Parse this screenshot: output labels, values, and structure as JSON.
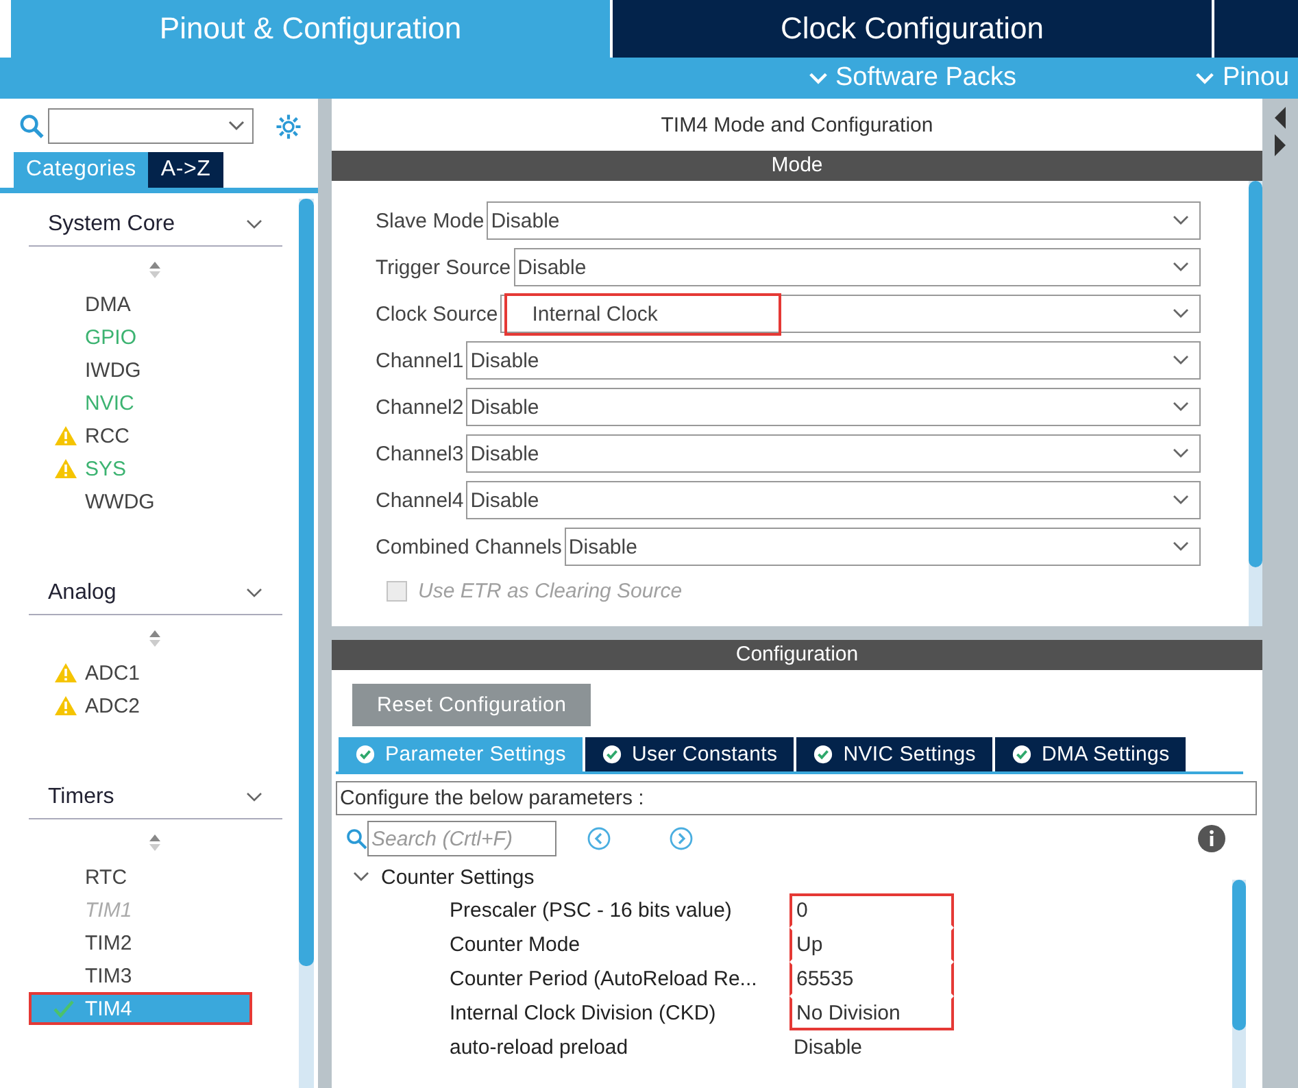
{
  "top_tabs": [
    {
      "label": "Pinout & Configuration",
      "selected": true
    },
    {
      "label": "Clock Configuration",
      "selected": false
    },
    {
      "selected": false
    }
  ],
  "sub_menu": [
    {
      "label": "Software Packs"
    },
    {
      "label": "Pinou"
    }
  ],
  "sidebar": {
    "tabs": [
      {
        "label": "Categories",
        "selected": true
      },
      {
        "label": "A->Z",
        "selected": false
      }
    ],
    "categories": [
      {
        "title": "System Core",
        "expanded": true,
        "items": [
          {
            "label": "DMA",
            "kind": "default",
            "warning": false,
            "checked": false,
            "selected": false,
            "highlighted": false
          },
          {
            "label": "GPIO",
            "kind": "configured",
            "warning": false,
            "checked": false,
            "selected": false,
            "highlighted": false
          },
          {
            "label": "IWDG",
            "kind": "default",
            "warning": false,
            "checked": false,
            "selected": false,
            "highlighted": false
          },
          {
            "label": "NVIC",
            "kind": "configured",
            "warning": false,
            "checked": false,
            "selected": false,
            "highlighted": false
          },
          {
            "label": "RCC",
            "kind": "default",
            "warning": true,
            "checked": false,
            "selected": false,
            "highlighted": false
          },
          {
            "label": "SYS",
            "kind": "configured",
            "warning": true,
            "checked": false,
            "selected": false,
            "highlighted": false
          },
          {
            "label": "WWDG",
            "kind": "default",
            "warning": false,
            "checked": false,
            "selected": false,
            "highlighted": false
          }
        ]
      },
      {
        "title": "Analog",
        "expanded": true,
        "items": [
          {
            "label": "ADC1",
            "kind": "default",
            "warning": true,
            "checked": false,
            "selected": false,
            "highlighted": false
          },
          {
            "label": "ADC2",
            "kind": "default",
            "warning": true,
            "checked": false,
            "selected": false,
            "highlighted": false
          }
        ]
      },
      {
        "title": "Timers",
        "expanded": true,
        "items": [
          {
            "label": "RTC",
            "kind": "default",
            "warning": false,
            "checked": false,
            "selected": false,
            "highlighted": false
          },
          {
            "label": "TIM1",
            "kind": "unavailable",
            "warning": false,
            "checked": false,
            "selected": false,
            "highlighted": false
          },
          {
            "label": "TIM2",
            "kind": "default",
            "warning": false,
            "checked": false,
            "selected": false,
            "highlighted": false
          },
          {
            "label": "TIM3",
            "kind": "default",
            "warning": false,
            "checked": false,
            "selected": false,
            "highlighted": false
          },
          {
            "label": "TIM4",
            "kind": "default",
            "warning": false,
            "checked": true,
            "selected": true,
            "highlighted": true
          }
        ]
      }
    ]
  },
  "panel_title": "TIM4 Mode and Configuration",
  "mode": {
    "header": "Mode",
    "fields": [
      {
        "label": "Slave Mode",
        "value": "Disable",
        "highlighted": false
      },
      {
        "label": "Trigger Source",
        "value": "Disable",
        "highlighted": false
      },
      {
        "label": "Clock Source",
        "value": "Internal Clock",
        "highlighted": true
      },
      {
        "label": "Channel1",
        "value": "Disable",
        "highlighted": false
      },
      {
        "label": "Channel2",
        "value": "Disable",
        "highlighted": false
      },
      {
        "label": "Channel3",
        "value": "Disable",
        "highlighted": false
      },
      {
        "label": "Channel4",
        "value": "Disable",
        "highlighted": false
      },
      {
        "label": "Combined Channels",
        "value": "Disable",
        "highlighted": false
      }
    ],
    "checkboxes": [
      {
        "label": "Use ETR as Clearing Source",
        "checked": false,
        "disabled": true
      }
    ]
  },
  "configuration": {
    "header": "Configuration",
    "reset_button": "Reset Configuration",
    "tabs": [
      {
        "label": "Parameter Settings",
        "selected": true
      },
      {
        "label": "User Constants",
        "selected": false
      },
      {
        "label": "NVIC Settings",
        "selected": false
      },
      {
        "label": "DMA Settings",
        "selected": false
      }
    ],
    "description": "Configure the below parameters :",
    "search": {
      "placeholder": "Search (Crtl+F)"
    },
    "group": {
      "title": "Counter Settings",
      "expanded": true,
      "params": [
        {
          "name": "Prescaler (PSC - 16 bits value)",
          "value": "0",
          "highlighted": true
        },
        {
          "name": "Counter Mode",
          "value": "Up",
          "highlighted": true
        },
        {
          "name": "Counter Period (AutoReload Re...",
          "value": "65535",
          "highlighted": true
        },
        {
          "name": "Internal Clock Division (CKD)",
          "value": "No Division",
          "highlighted": true
        },
        {
          "name": "auto-reload preload",
          "value": "Disable",
          "highlighted": false
        }
      ]
    }
  }
}
